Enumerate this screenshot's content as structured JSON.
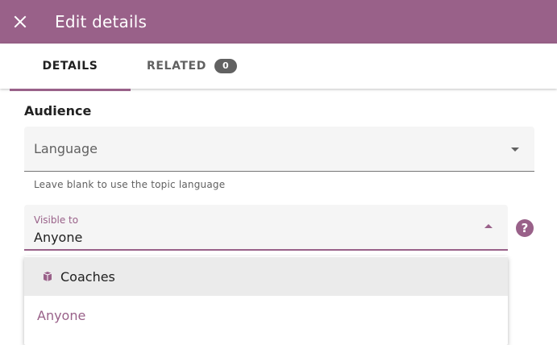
{
  "appbar": {
    "title": "Edit details",
    "close_icon": "close-icon",
    "background_color": "#996189"
  },
  "tabs": [
    {
      "label": "DETAILS",
      "active": true
    },
    {
      "label": "RELATED",
      "badge": "0",
      "active": false
    }
  ],
  "audience": {
    "heading": "Audience",
    "language": {
      "placeholder": "Language",
      "hint": "Leave blank to use the topic language",
      "icon": "dropdown-arrow-icon"
    },
    "visible_to": {
      "label": "Visible to",
      "value": "Anyone",
      "icon": "dropdown-arrow-up-icon",
      "help_icon": "help-icon",
      "options": [
        {
          "label": "Coaches",
          "icon": "coach-icon",
          "highlighted": true
        },
        {
          "label": "Anyone",
          "selected": true
        }
      ]
    }
  },
  "colors": {
    "accent": "#996189",
    "field_background": "#f5f5f5",
    "badge": "#616161"
  }
}
